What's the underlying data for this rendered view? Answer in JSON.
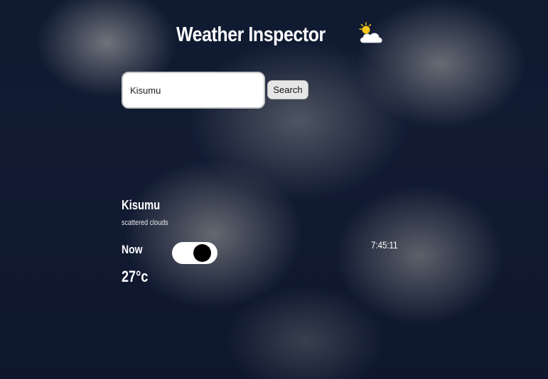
{
  "app": {
    "title": "Weather Inspector",
    "logo_icon": "partly-cloudy-icon"
  },
  "search": {
    "value": "Kisumu",
    "button_label": "Search"
  },
  "weather": {
    "city": "Kisumu",
    "description": "scattered clouds",
    "now_label": "Now",
    "temperature": "27°c",
    "time": "7:45:11"
  },
  "toggle": {
    "state": "on",
    "icon": "toggle-switch-icon"
  },
  "colors": {
    "text": "#ffffff",
    "toggle_track": "#ffffff",
    "toggle_knob": "#000000",
    "sun": "#f5c518"
  }
}
